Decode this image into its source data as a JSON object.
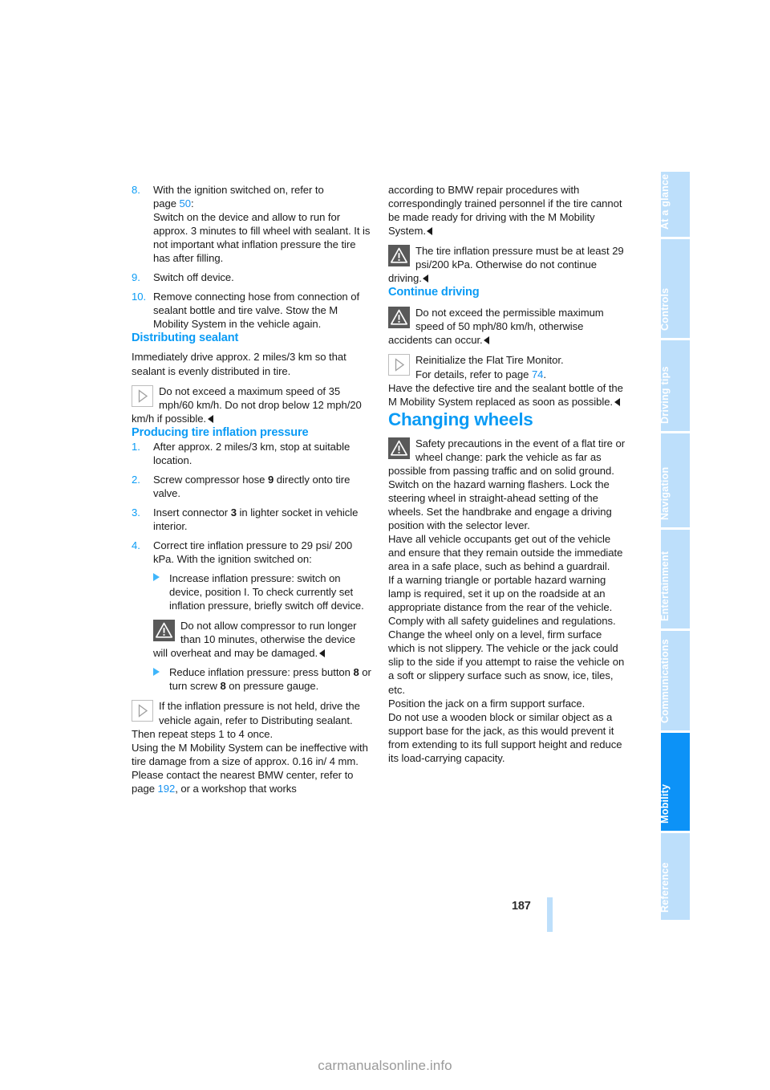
{
  "document": {
    "page_number": "187",
    "watermark": "carmanualsonline.info",
    "accent_color": "#0a9bf5",
    "link_color": "#1692f0",
    "tab_inactive_color": "#bddffb",
    "tab_active_color": "#0c92f7"
  },
  "tabs": [
    {
      "label": "At a glance",
      "active": false
    },
    {
      "label": "Controls",
      "active": false
    },
    {
      "label": "Driving tips",
      "active": false
    },
    {
      "label": "Navigation",
      "active": false
    },
    {
      "label": "Entertainment",
      "active": false
    },
    {
      "label": "Communications",
      "active": false
    },
    {
      "label": "Mobility",
      "active": true
    },
    {
      "label": "Reference",
      "active": false
    }
  ],
  "left_column": {
    "step8": {
      "num": "8.",
      "line1": "With the ignition switched on, refer to",
      "line2_prefix": "page ",
      "line2_ref": "50",
      "line2_suffix": ":",
      "rest": "Switch on the device and allow to run for approx. 3 minutes to fill wheel with sealant. It is not important what inflation pressure the tire has after filling."
    },
    "step9": {
      "num": "9.",
      "text": "Switch off device."
    },
    "step10": {
      "num": "10.",
      "text": "Remove connecting hose from connection of sealant bottle and tire valve. Stow the M Mobility System in the vehicle again."
    },
    "distributing": {
      "heading": "Distributing sealant",
      "intro": "Immediately drive approx. 2 miles/3 km so that sealant is evenly distributed in tire.",
      "note_icon": "note-icon",
      "note": "Do not exceed a maximum speed of 35 mph/60 km/h. Do not drop below 12 mph/20 km/h if possible."
    },
    "producing": {
      "heading": "Producing tire inflation pressure",
      "step1": {
        "num": "1.",
        "text": "After approx. 2 miles/3 km, stop at suitable location."
      },
      "step2": {
        "num": "2.",
        "pre": "Screw compressor hose ",
        "bold": "9",
        "post": " directly onto tire valve."
      },
      "step3": {
        "num": "3.",
        "pre": "Insert connector ",
        "bold": "3",
        "post": " in lighter socket in vehicle interior."
      },
      "step4": {
        "num": "4.",
        "text": "Correct tire inflation pressure to 29 psi/ 200 kPa. With the ignition switched on:"
      },
      "bullet1": "Increase inflation pressure: switch on device, position I. To check currently set inflation pressure, briefly switch off device.",
      "warning_icon": "warning-icon",
      "warning": "Do not allow compressor to run longer than 10 minutes, otherwise the device will overheat and may be damaged.",
      "bullet2_pre": "Reduce inflation pressure: press button ",
      "bullet2_bold1": "8",
      "bullet2_mid": " or turn screw ",
      "bullet2_bold2": "8",
      "bullet2_post": " on pressure gauge.",
      "note_icon": "note-icon",
      "note": "If the inflation pressure is not held, drive the vehicle again, refer to Distributing sealant. Then repeat steps 1 to 4 once.",
      "closing_part1": "Using the M Mobility System can be ineffective with tire damage from a size of approx. 0.16 in/ 4 mm. Please contact the nearest BMW center, refer to page ",
      "closing_ref": "192",
      "closing_part2": ", or a workshop that works"
    }
  },
  "right_column": {
    "continuation": {
      "text": "according to BMW repair procedures with correspondingly trained personnel if the tire cannot be made ready for driving with the M Mobility System."
    },
    "warning1": {
      "icon": "warning-icon",
      "text": "The tire inflation pressure must be at least 29 psi/200 kPa. Otherwise do not continue driving."
    },
    "continue_driving": {
      "heading": "Continue driving",
      "warning_icon": "warning-icon",
      "warning": "Do not exceed the permissible maximum speed of 50 mph/80 km/h, otherwise accidents can occur.",
      "note_icon": "note-icon",
      "note_line1": "Reinitialize the Flat Tire Monitor.",
      "note_line2_pre": "For details, refer to page ",
      "note_line2_ref": "74",
      "note_line2_post": ".",
      "note_rest": "Have the defective tire and the sealant bottle of the M Mobility System replaced as soon as possible."
    },
    "changing_wheels": {
      "heading": "Changing wheels",
      "warning_icon": "warning-icon",
      "warning": "Safety precautions in the event of a flat tire or wheel change: park the vehicle as far as possible from passing traffic and on solid ground. Switch on the hazard warning flashers. Lock the steering wheel in straight-ahead setting of the wheels. Set the handbrake and engage a driving position with the selector lever.",
      "para2": "Have all vehicle occupants get out of the vehicle and ensure that they remain outside the immediate area in a safe place, such as behind a guardrail.",
      "para3": "If a warning triangle or portable hazard warning lamp is required, set it up on the roadside at an appropriate distance from the rear of the vehicle. Comply with all safety guidelines and regulations.",
      "para4": "Change the wheel only on a level, firm surface which is not slippery. The vehicle or the jack could slip to the side if you attempt to raise the vehicle on a soft or slippery surface such as snow, ice, tiles, etc.",
      "para5": "Position the jack on a firm support surface.",
      "para6": "Do not use a wooden block or similar object as a support base for the jack, as this would prevent it from extending to its full support height and reduce its load-carrying capacity."
    }
  }
}
